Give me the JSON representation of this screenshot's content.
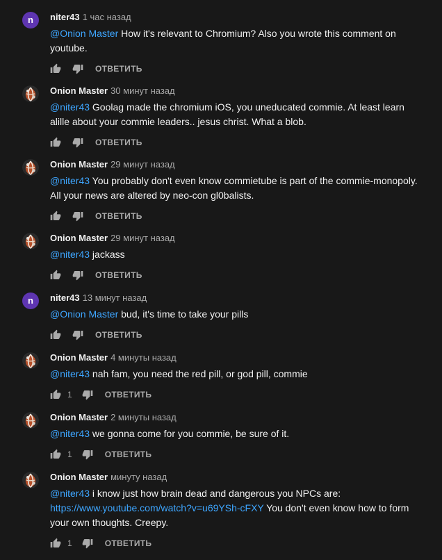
{
  "colors": {
    "background": "#181818",
    "text": "#f1f1f1",
    "muted": "#aaaaaa",
    "link": "#3ea6ff",
    "avatar_n": "#5e35b1"
  },
  "icons": {
    "like": "thumb-up-icon",
    "dislike": "thumb-down-icon"
  },
  "reply_label": "ОТВЕТИТЬ",
  "comments": [
    {
      "author": "niter43",
      "avatar": "n",
      "time": "1 час назад",
      "mention": "@Onion Master",
      "text": " How it's relevant to Chromium? Also you wrote this comment on youtube.",
      "likes": ""
    },
    {
      "author": "Onion Master",
      "avatar": "onion",
      "time": "30 минут назад",
      "mention": "@niter43",
      "text": " Goolag made the chromium iOS, you uneducated commie. At least learn alille about your commie leaders.. jesus christ. What a blob.",
      "likes": ""
    },
    {
      "author": "Onion Master",
      "avatar": "onion",
      "time": "29 минут назад",
      "mention": "@niter43",
      "text": " You probably don't even know commietube is part of the commie-monopoly. All your news are altered by neo-con gl0balists.",
      "likes": ""
    },
    {
      "author": "Onion Master",
      "avatar": "onion",
      "time": "29 минут назад",
      "mention": "@niter43",
      "text": " jackass",
      "likes": ""
    },
    {
      "author": "niter43",
      "avatar": "n",
      "time": "13 минут назад",
      "mention": "@Onion Master",
      "text": " bud, it's time to take your pills",
      "likes": ""
    },
    {
      "author": "Onion Master",
      "avatar": "onion",
      "time": "4 минуты назад",
      "mention": "@niter43",
      "text": " nah fam, you need the red pill, or god pill, commie",
      "likes": "1"
    },
    {
      "author": "Onion Master",
      "avatar": "onion",
      "time": "2 минуты назад",
      "mention": "@niter43",
      "text": " we gonna come for you commie, be sure of it.",
      "likes": "1"
    },
    {
      "author": "Onion Master",
      "avatar": "onion",
      "time": "минуту назад",
      "mention": "@niter43",
      "text": " i know just how brain dead and dangerous you NPCs are: ",
      "link": "https://www.youtube.com/watch?v=u69YSh-cFXY",
      "text_after": " You don't even know how to form your own thoughts. Creepy.",
      "likes": "1"
    }
  ]
}
